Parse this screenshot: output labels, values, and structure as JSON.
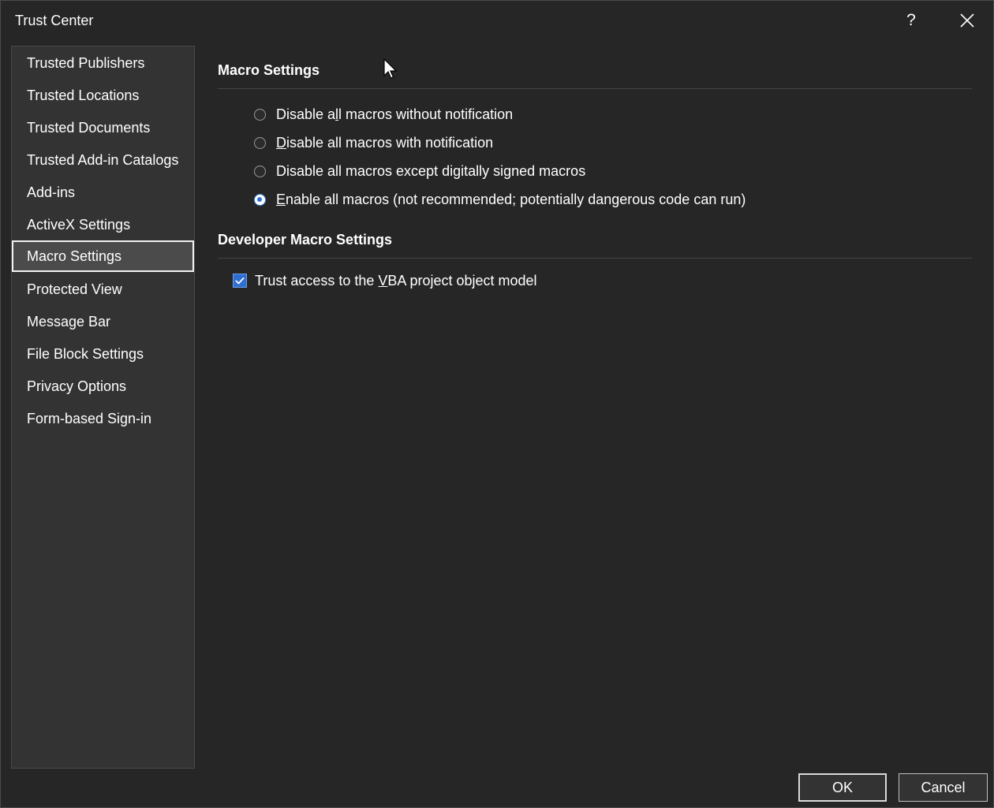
{
  "window": {
    "title": "Trust Center",
    "help_label": "?",
    "close_icon": "close-icon"
  },
  "sidebar": {
    "items": [
      {
        "label": "Trusted Publishers",
        "selected": false
      },
      {
        "label": "Trusted Locations",
        "selected": false
      },
      {
        "label": "Trusted Documents",
        "selected": false
      },
      {
        "label": "Trusted Add-in Catalogs",
        "selected": false
      },
      {
        "label": "Add-ins",
        "selected": false
      },
      {
        "label": "ActiveX Settings",
        "selected": false
      },
      {
        "label": "Macro Settings",
        "selected": true
      },
      {
        "label": "Protected View",
        "selected": false
      },
      {
        "label": "Message Bar",
        "selected": false
      },
      {
        "label": "File Block Settings",
        "selected": false
      },
      {
        "label": "Privacy Options",
        "selected": false
      },
      {
        "label": "Form-based Sign-in",
        "selected": false
      }
    ]
  },
  "macro_settings": {
    "title": "Macro Settings",
    "options": [
      {
        "pre": "Disable a",
        "key": "l",
        "post": "l macros without notification",
        "checked": false
      },
      {
        "pre": "",
        "key": "D",
        "post": "isable all macros with notification",
        "checked": false
      },
      {
        "pre": "Disable all macros except di",
        "key": "g",
        "post": "itally signed macros",
        "checked": false
      },
      {
        "pre": "",
        "key": "E",
        "post": "nable all macros (not recommended; potentially dangerous code can run)",
        "checked": true
      }
    ]
  },
  "developer_settings": {
    "title": "Developer Macro Settings",
    "vba_access": {
      "pre": "Trust access to the ",
      "key": "V",
      "post": "BA project object model",
      "checked": true
    }
  },
  "buttons": {
    "ok": "OK",
    "cancel": "Cancel"
  },
  "colors": {
    "background": "#262626",
    "sidebar": "#333333",
    "accent": "#2f72d6"
  }
}
